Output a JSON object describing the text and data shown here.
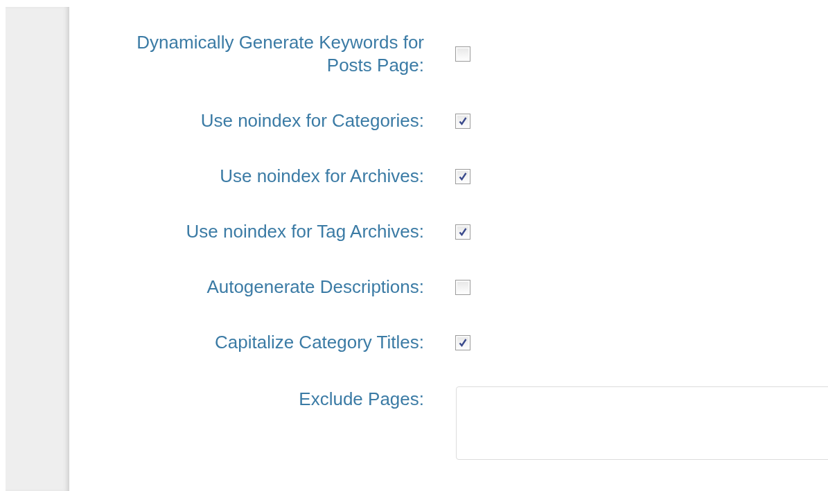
{
  "settings": [
    {
      "kind": "checkbox",
      "label": "Dynamically Generate Keywords for Posts Page:",
      "checked": false
    },
    {
      "kind": "checkbox",
      "label": "Use noindex for Categories:",
      "checked": true
    },
    {
      "kind": "checkbox",
      "label": "Use noindex for Archives:",
      "checked": true
    },
    {
      "kind": "checkbox",
      "label": "Use noindex for Tag Archives:",
      "checked": true
    },
    {
      "kind": "checkbox",
      "label": "Autogenerate Descriptions:",
      "checked": false
    },
    {
      "kind": "checkbox",
      "label": "Capitalize Category Titles:",
      "checked": true
    },
    {
      "kind": "textarea",
      "label": "Exclude Pages:"
    }
  ]
}
